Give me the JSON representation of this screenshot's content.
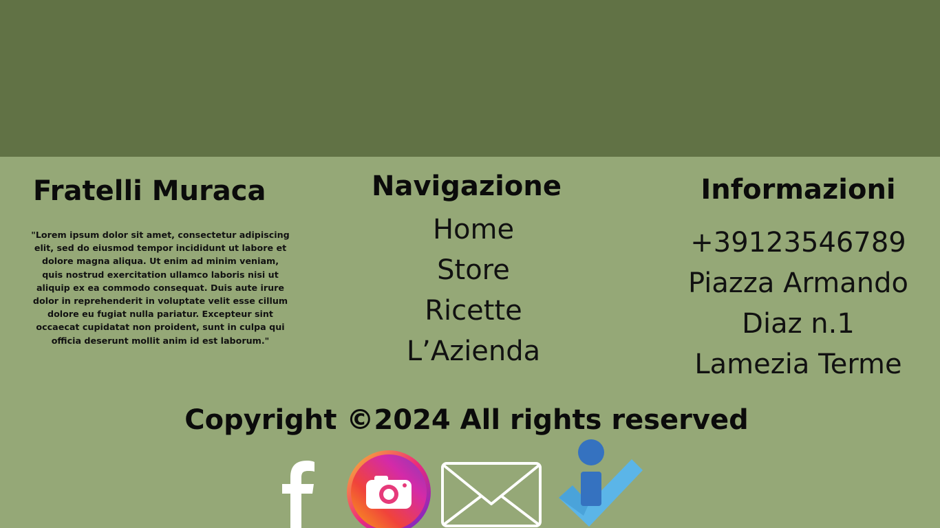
{
  "brand": {
    "title": "Fratelli Muraca",
    "quote": "\"Lorem ipsum dolor sit amet, consectetur adipiscing elit, sed do eiusmod tempor incididunt ut labore et dolore magna aliqua. Ut enim ad minim veniam, quis nostrud exercitation ullamco laboris nisi ut aliquip ex ea commodo consequat. Duis aute irure dolor in reprehenderit in voluptate velit esse cillum dolore eu fugiat nulla pariatur. Excepteur sint occaecat cupidatat non proident, sunt in culpa qui officia deserunt mollit anim id est laborum.\""
  },
  "navigation": {
    "title": "Navigazione",
    "items": [
      {
        "label": "Home"
      },
      {
        "label": "Store"
      },
      {
        "label": "Ricette"
      },
      {
        "label": "L’Azienda"
      }
    ]
  },
  "info": {
    "title": "Informazioni",
    "phone": "+39123546789",
    "address_line1": "Piazza Armando",
    "address_line2": "Diaz n.1",
    "city": "Lamezia Terme"
  },
  "footer": {
    "copyright": "Copyright ©2024 All rights reserved"
  },
  "social": {
    "icons": [
      "facebook-icon",
      "instagram-icon",
      "mail-icon",
      "info-icon"
    ]
  },
  "colors": {
    "top_band": "#617245",
    "footer_bg": "#95a877",
    "text": "#0b0b0b",
    "icon_white": "#ffffff",
    "info_blue": "#3572c0",
    "info_light_blue": "#5bb5e8"
  }
}
